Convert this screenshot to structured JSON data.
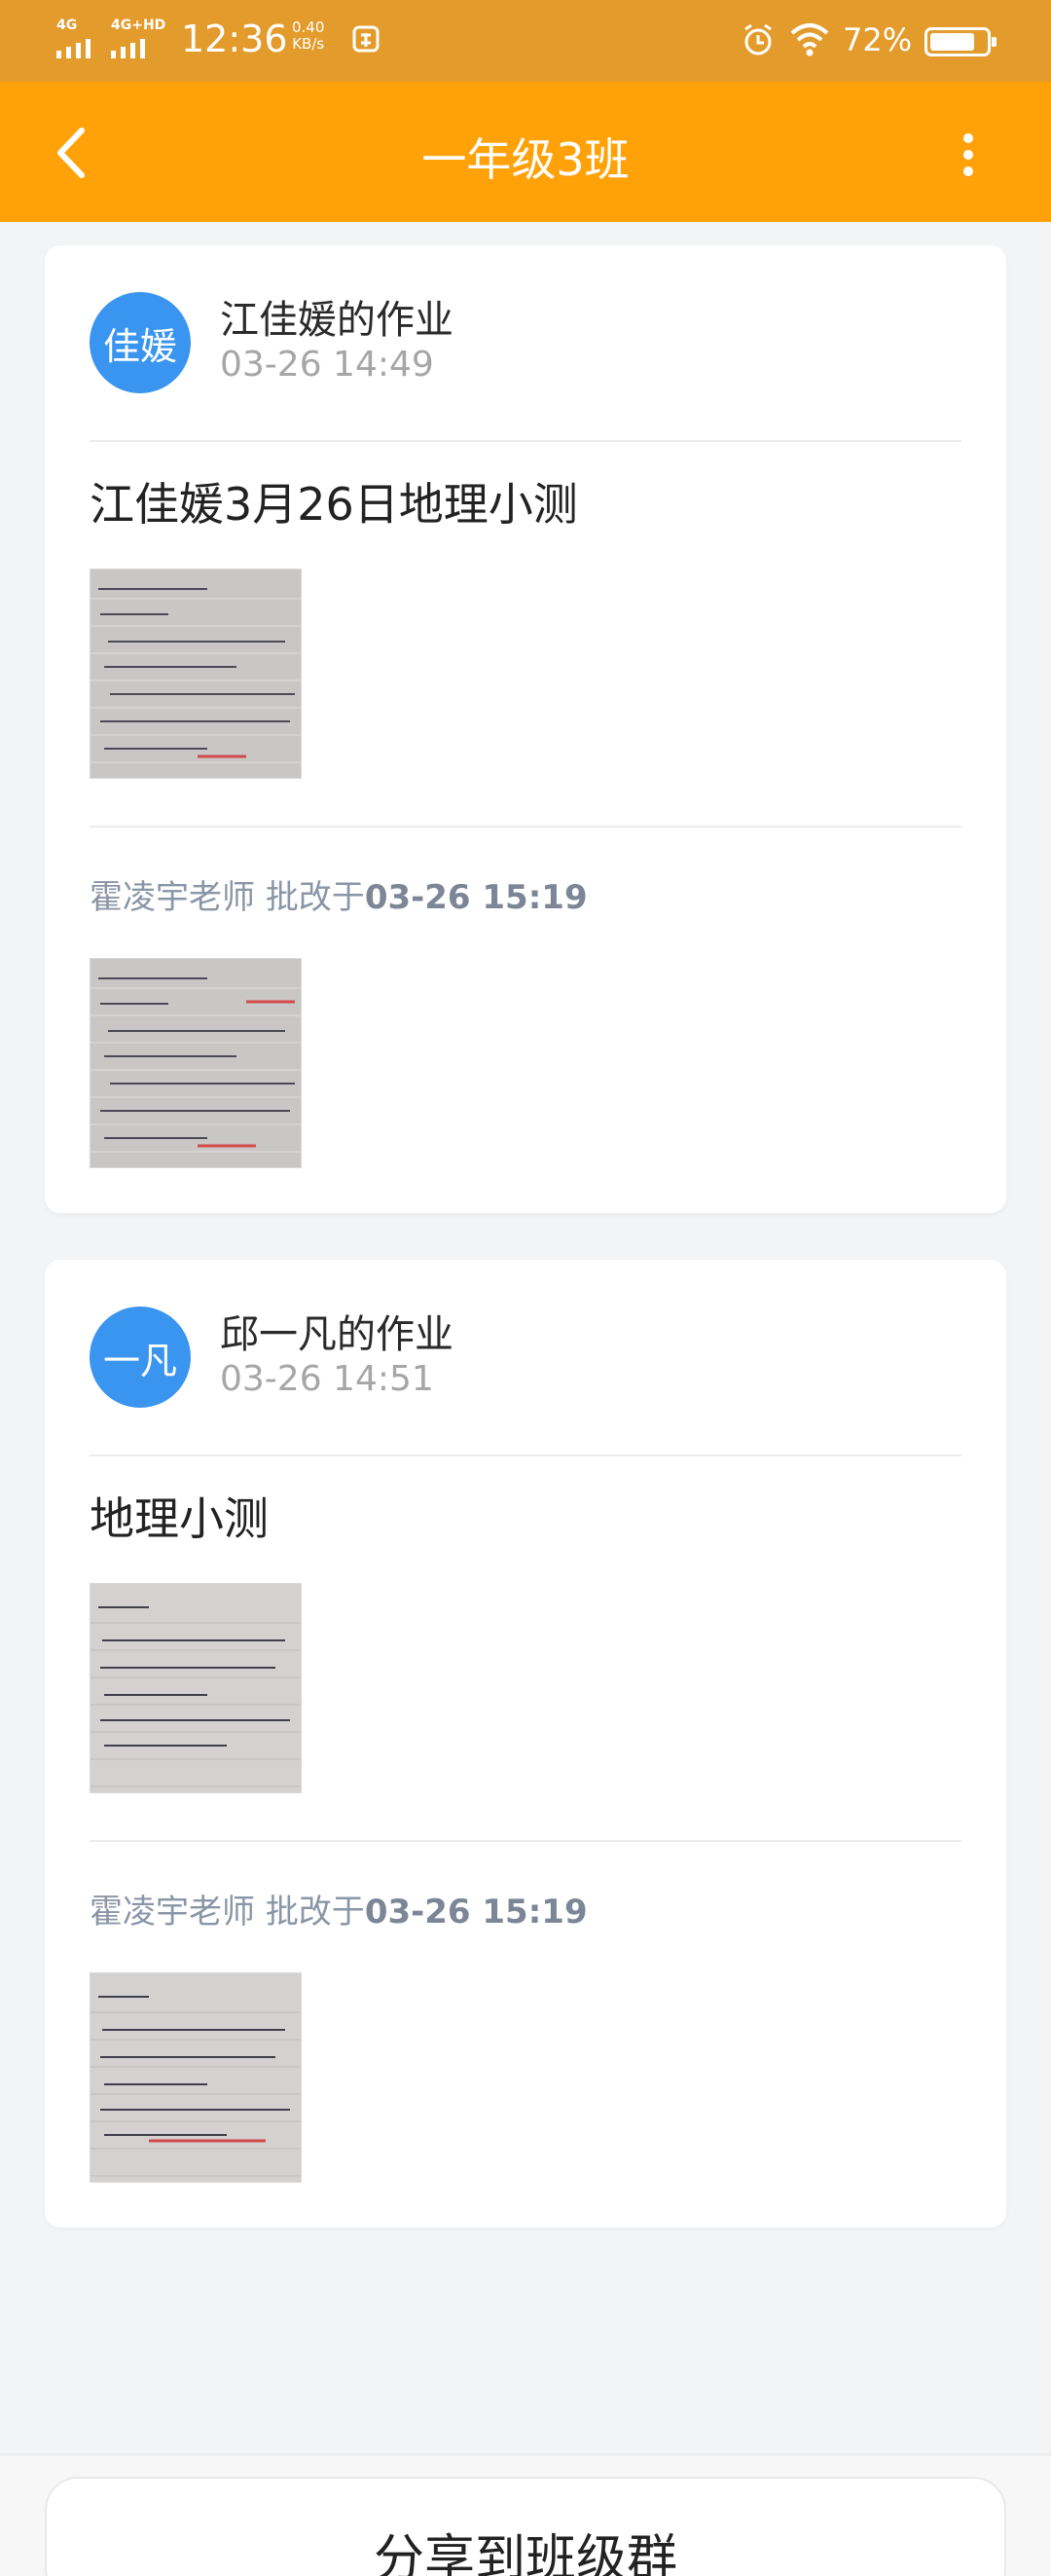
{
  "status_bar": {
    "signal1_label": "4G",
    "signal2_label": "4G+HD",
    "time": "12:36",
    "speed_value": "0.40",
    "speed_unit": "KB/s",
    "battery_percent": "72%",
    "icons": [
      "signal-icon",
      "signal-icon",
      "data-saver-icon",
      "alarm-icon",
      "wifi-icon",
      "battery-icon"
    ]
  },
  "app_bar": {
    "title": "一年级3班",
    "back_icon": "chevron-left-icon",
    "menu_icon": "more-vertical-icon"
  },
  "submissions": [
    {
      "avatar_text": "佳媛",
      "student_label": "江佳媛的作业",
      "submitted_at": "03-26 14:49",
      "homework_title": "江佳媛3月26日地理小测",
      "reviewer": "霍凌宇老师",
      "review_prefix": "批改于",
      "reviewed_at": "03-26 15:19"
    },
    {
      "avatar_text": "一凡",
      "student_label": "邱一凡的作业",
      "submitted_at": "03-26 14:51",
      "homework_title": "地理小测",
      "reviewer": "霍凌宇老师",
      "review_prefix": "批改于",
      "reviewed_at": "03-26 15:19"
    }
  ],
  "share_button": "分享到班级群",
  "colors": {
    "status_bar": "#e39b2b",
    "app_bar": "#ffa20a",
    "avatar": "#3a95f0",
    "background": "#f3f4f6"
  }
}
